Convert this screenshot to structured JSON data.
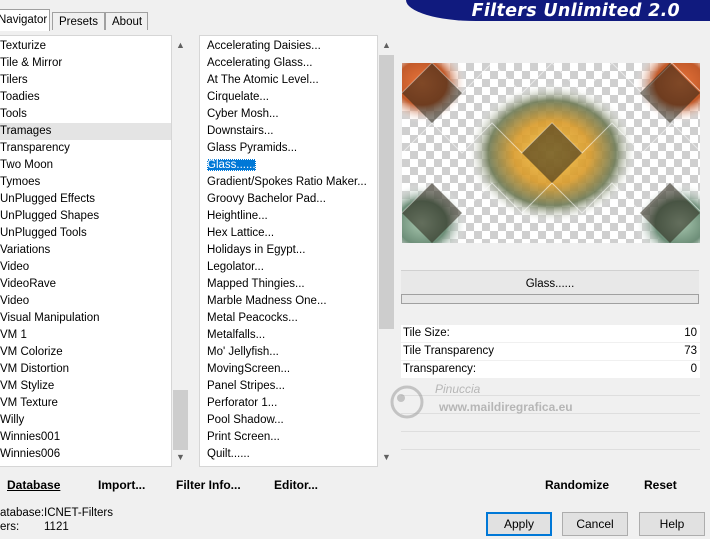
{
  "tabs": [
    "Navigator",
    "Presets",
    "About"
  ],
  "banner": {
    "title": "Filters Unlimited 2.0"
  },
  "categories": [
    "Texturize",
    "Tile & Mirror",
    "Tilers",
    "Toadies",
    "Tools",
    "Tramages",
    "Transparency",
    "Two Moon",
    "Tymoes",
    "UnPlugged Effects",
    "UnPlugged Shapes",
    "UnPlugged Tools",
    "Variations",
    "Video",
    "VideoRave",
    "Video",
    "Visual Manipulation",
    "VM 1",
    "VM Colorize",
    "VM Distortion",
    "VM Stylize",
    "VM Texture",
    "Willy",
    "Winnies001",
    "Winnies006"
  ],
  "categories_selected": "Tramages",
  "filters": [
    "Accelerating Daisies...",
    "Accelerating Glass...",
    "At The Atomic Level...",
    "Cirquelate...",
    "Cyber Mosh...",
    "Downstairs...",
    "Glass Pyramids...",
    "Glass......",
    "Gradient/Spokes Ratio Maker...",
    "Groovy Bachelor Pad...",
    "Heightline...",
    "Hex Lattice...",
    "Holidays in Egypt...",
    "Legolator...",
    "Mapped Thingies...",
    "Marble Madness One...",
    "Metal Peacocks...",
    "Metalfalls...",
    "Mo' Jellyfish...",
    "MovingScreen...",
    "Panel Stripes...",
    "Perforator 1...",
    "Pool Shadow...",
    "Print Screen...",
    "Quilt......"
  ],
  "filters_selected": "Glass......",
  "left_buttons": {
    "database": "Database",
    "import": "Import...",
    "filter_info": "Filter Info...",
    "editor": "Editor..."
  },
  "filter_name": "Glass......",
  "params": [
    {
      "label": "Tile Size:",
      "value": "10"
    },
    {
      "label": "Tile Transparency",
      "value": "73"
    },
    {
      "label": "Transparency:",
      "value": "0"
    }
  ],
  "right_buttons": {
    "randomize": "Randomize",
    "reset": "Reset"
  },
  "status": {
    "database_label": "atabase:",
    "database_value": "ICNET-Filters",
    "filters_label": "ers:",
    "filters_value": "1121"
  },
  "dialog_buttons": {
    "apply": "Apply",
    "cancel": "Cancel",
    "help": "Help"
  },
  "watermark": {
    "line1": "Pinuccia",
    "line2": "www.maildiregrafica.eu"
  },
  "colors": {
    "banner": "#101a7e",
    "selection": "#0078d7"
  }
}
